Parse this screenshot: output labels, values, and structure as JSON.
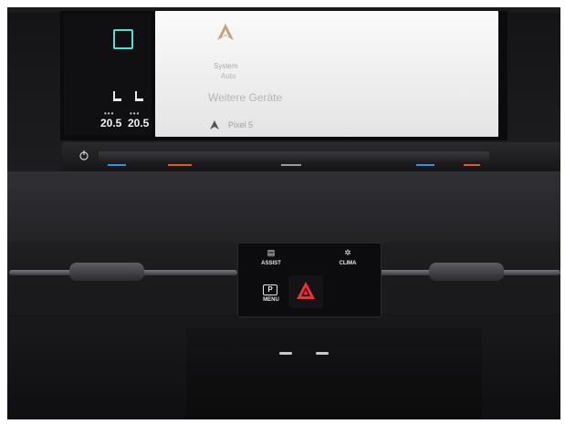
{
  "screen": {
    "left_temp": "20.5",
    "right_temp": "20.5",
    "system_text": "System",
    "auto_text": "Auto",
    "more_devices": "Weitere Geräte",
    "device_name": "Pixel 5"
  },
  "console": {
    "assist_label": "ASSIST",
    "clima_label": "CLIMA",
    "menu_label": "MENU",
    "park_symbol": "P"
  },
  "colors": {
    "accent_teal": "#4fe0d8",
    "hazard_red": "#ff2b2b",
    "aa_logo_tan": "#c9a07c"
  },
  "icons": [
    "home-square-icon",
    "seat-heat-icon",
    "android-auto-icon",
    "power-icon",
    "assist-icon",
    "clima-icon",
    "park-icon",
    "hazard-icon"
  ]
}
